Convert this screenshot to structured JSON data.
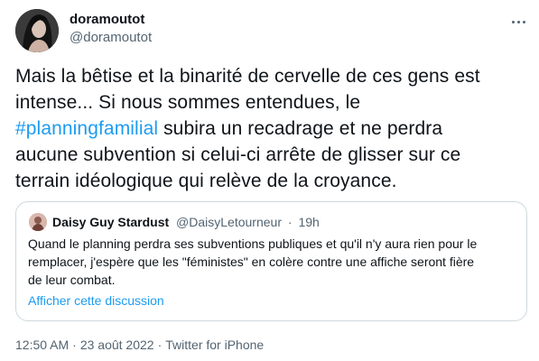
{
  "author": {
    "display_name": "doramoutot",
    "handle": "@doramoutot",
    "avatar_icon": "profile-photo-icon"
  },
  "tweet": {
    "lines": [
      {
        "before": "Mais la bêtise et la binarité de cervelle de ces gens est",
        "hashtag": "",
        "after": ""
      },
      {
        "before": "intense... Si nous sommes entendues, le",
        "hashtag": "",
        "after": ""
      },
      {
        "before": "",
        "hashtag": "#planningfamilial",
        "after": " subira un recadrage et ne perdra"
      },
      {
        "before": "aucune subvention si celui-ci arrête de glisser sur ce",
        "hashtag": "",
        "after": ""
      },
      {
        "before": "terrain idéologique qui relève de la croyance.",
        "hashtag": "",
        "after": ""
      }
    ]
  },
  "quote": {
    "display_name": "Daisy Guy Stardust",
    "handle": "@DaisyLetourneur",
    "separator": "·",
    "time": "19h",
    "lines": [
      "Quand le planning perdra ses subventions publiques et qu'il n'y aura rien pour le",
      "remplacer, j'espère que les \"féministes\" en colère contre une affiche seront fière",
      "de leur combat."
    ],
    "show_thread_label": "Afficher cette discussion"
  },
  "meta": {
    "time": "12:50 AM",
    "separator": "·",
    "date": "23 août 2022",
    "source": "Twitter for iPhone"
  },
  "colors": {
    "link": "#1d9bf0",
    "text": "#0f1419",
    "secondary": "#536471",
    "border": "#cfd9de"
  }
}
